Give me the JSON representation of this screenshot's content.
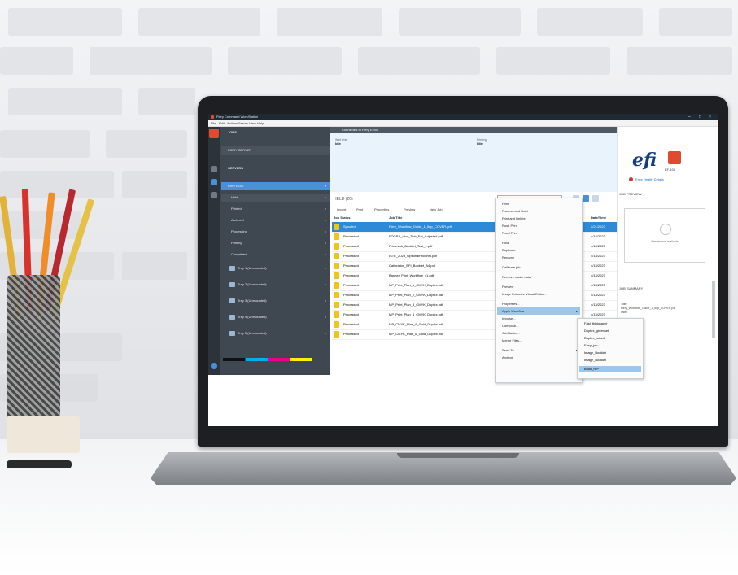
{
  "window": {
    "title": "Fiery Command WorkStation",
    "controls": [
      "–",
      "□",
      "×"
    ]
  },
  "menubar": [
    "File",
    "Edit",
    "Actions",
    "Server",
    "View",
    "Help"
  ],
  "sidebar": {
    "jobs_label": "JOBS",
    "server_row": "FIERY SERVER",
    "servers_label": "SERVERS",
    "selected_server": "Fiery E200",
    "items": [
      {
        "label": "Held"
      },
      {
        "label": "Printed"
      },
      {
        "label": "Archived"
      },
      {
        "label": "Processing"
      },
      {
        "label": "Printing"
      },
      {
        "label": "Completed"
      }
    ],
    "media": [
      {
        "label": "Tray 1 (Unmounted)"
      },
      {
        "label": "Tray 2 (Unmounted)"
      },
      {
        "label": "Tray 3 (Unmounted)"
      },
      {
        "label": "Tray 4 (Unmounted)"
      },
      {
        "label": "Tray 5 (Unmounted)"
      }
    ]
  },
  "main": {
    "header": "Connected to Fiery E200",
    "banner": {
      "left_label": "Wait time",
      "left_value": "Idle",
      "right_label": "Printing",
      "right_value": "Idle"
    },
    "held_count": "HELD (20)",
    "search_placeholder": "Search",
    "toolbar": [
      "Import",
      "Print",
      "Properties",
      "Preview",
      "New Job"
    ],
    "columns": [
      "Job Status",
      "Job Title",
      "Date/Time"
    ],
    "rows": [
      {
        "status": "Spooled",
        "title": "Fiery_Workflow_Guide_1_5up_COVER.pdf",
        "date": "2/21/2023"
      },
      {
        "status": "Processed",
        "title": "FOGRA_Lino_Test_Ext_Adjusted.pdf",
        "date": "4/18/2023"
      },
      {
        "status": "Processed",
        "title": "Printmark_Booklet_Test_1.pdf",
        "date": "4/13/2023"
      },
      {
        "status": "Processed",
        "title": "ISTE_2023_OptionalProdinfo.pdf",
        "date": "4/13/2023"
      },
      {
        "status": "Processed",
        "title": "Calibration_EFI_Booklet_A4.pdf",
        "date": "4/13/2023"
      },
      {
        "status": "Processed",
        "title": "Banner_Print_Workflow_v1.pdf",
        "date": "4/13/2023"
      },
      {
        "status": "Processed",
        "title": "MP_Print_Plan_1_CMYK_Duplex.pdf",
        "date": "4/13/2023"
      },
      {
        "status": "Processed",
        "title": "MP_Print_Plan_2_CMYK_Duplex.pdf",
        "date": "4/13/2023"
      },
      {
        "status": "Processed",
        "title": "MP_Print_Plan_3_CMYK_Duplex.pdf",
        "date": "4/13/2023"
      },
      {
        "status": "Processed",
        "title": "MP_Print_Plan_4_CMYK_Duplex.pdf",
        "date": "4/13/2023"
      },
      {
        "status": "Processed",
        "title": "MP_CMYK_Plan_5_Gold_Duplex.pdf",
        "date": "4/13/2023"
      },
      {
        "status": "Processed",
        "title": "MP_CMYK_Plan_6_Gold_Duplex.pdf",
        "date": "4/13/2023"
      }
    ]
  },
  "context_menu": {
    "items": [
      {
        "label": "Print"
      },
      {
        "label": "Process and Hold"
      },
      {
        "label": "Print and Delete"
      },
      {
        "label": "Rush Print"
      },
      {
        "label": "Proof Print"
      },
      {
        "label": "Hold"
      },
      {
        "label": "Duplicate"
      },
      {
        "label": "Rename"
      },
      {
        "label": "Calibrate job..."
      },
      {
        "label": "Remove raster data"
      },
      {
        "label": "Preview"
      },
      {
        "label": "Image Enhance Visual Editor..."
      },
      {
        "label": "Properties..."
      },
      {
        "label": "Apply Workflow",
        "highlight": true,
        "submenu": true
      },
      {
        "label": "Impose..."
      },
      {
        "label": "Compose..."
      },
      {
        "label": "JobMaster..."
      },
      {
        "label": "Merge Files..."
      },
      {
        "label": "Send To",
        "submenu": true
      },
      {
        "label": "Archive"
      }
    ],
    "submenu": [
      {
        "label": "Fast_thickpaper"
      },
      {
        "label": "Duplex_greenset"
      },
      {
        "label": "Duplex_mixed"
      },
      {
        "label": "Easy_job"
      },
      {
        "label": "Image_Booklet"
      },
      {
        "label": "Image_Booklet"
      },
      {
        "label": "Book_RIP",
        "highlight": true
      }
    ]
  },
  "right_panel": {
    "brand": "efi",
    "model": "EF-100",
    "status_link": "Error Health Details",
    "preview_section": "JOB PREVIEW",
    "preview_message": "Preview not available",
    "summary_section": "JOB SUMMARY",
    "summary_title": "Title:",
    "summary_value": "Fiery_Workflow_Guide_1_5up_COVER.pdf",
    "summary_user": "User:"
  },
  "colors": {
    "accent": "#2d8ad6",
    "brand": "#e04b2f",
    "sidebar": "#3f4750"
  }
}
